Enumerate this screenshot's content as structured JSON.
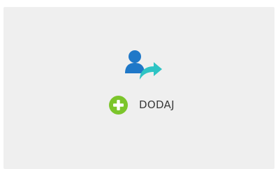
{
  "card": {
    "icon": "user-share-icon",
    "add_action": {
      "label": "DODAJ",
      "icon": "plus-circle-icon"
    }
  },
  "colors": {
    "card_background": "#efefef",
    "user_blue": "#1f78c8",
    "arrow_teal": "#2ec4c4",
    "plus_green": "#7cc52b",
    "label_text": "#3a3a3a"
  }
}
